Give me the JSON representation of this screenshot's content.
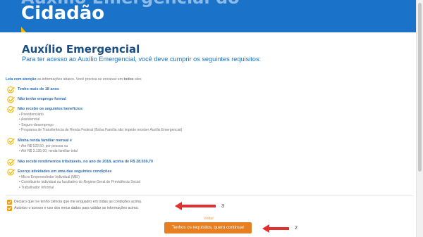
{
  "banner": {
    "top_text": "Auxílio Emergencial do",
    "title": "Cidadão"
  },
  "heading": "Auxílio Emergencial",
  "subheading": "Para ter acesso ao Auxílio Emergencial, você deve cumprir os seguintes requisitos:",
  "intro": {
    "highlight": "Leia com atenção",
    "text": " as informações abaixo. Você precisa se encaixar em ",
    "bold": "todos",
    "tail": " eles"
  },
  "requirements": [
    {
      "title": "Tenho mais de 18 anos",
      "items": []
    },
    {
      "title": "Não tenho emprego formal",
      "items": []
    },
    {
      "title": "Não recebo os seguintes benefícios",
      "items": [
        "Previdenciário",
        "Assistencial",
        "Seguro-desemprego",
        "Programa de Transferência de Renda Federal (Bolsa Família não impede receber Auxílio Emergencial)"
      ]
    },
    {
      "title": "Minha renda familiar mensal é",
      "items": [
        "Até R$ 522,50, por pessoa ou",
        "Até R$ 3.135,00, renda familiar total"
      ]
    },
    {
      "title": "Não recebi rendimentos tributáveis, no ano de 2018, acima de R$ 28.559,70",
      "items": []
    },
    {
      "title": "Exerço atividades em uma das seguintes condições",
      "items": [
        "Micro Empreendedor Individual (MEI)",
        "Contribuinte individual ou facultativo do Regime Geral de Previdência Social",
        "Trabalhador Informal"
      ]
    }
  ],
  "checkboxes": [
    {
      "label": "Declaro que li e tenho ciência que me enquadro em todas as condições acima."
    },
    {
      "label": "Autorizo o acesso e uso dos meus dados para validar as informações acima."
    }
  ],
  "back_label": "Voltar",
  "continue_label": "Tenhos os requisitos, quero continuar",
  "annotations": {
    "arrow_checkbox_number": "3",
    "arrow_button_number": "2"
  },
  "colors": {
    "banner": "#1b73c9",
    "accent": "#e67e22",
    "check": "#f5b800",
    "annotation": "#e32f2f"
  },
  "icons": {
    "requirement": "checkmark-circle-icon"
  }
}
